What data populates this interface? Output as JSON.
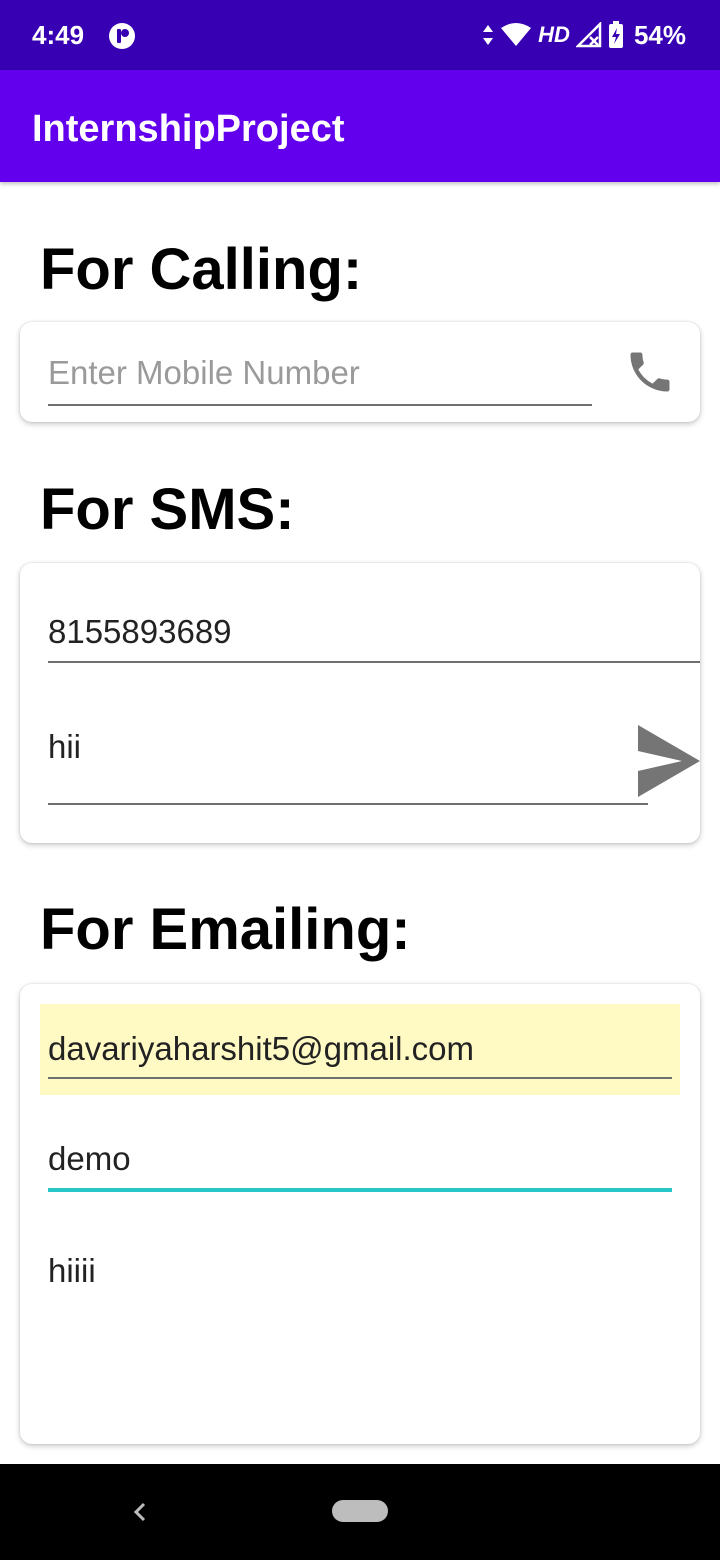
{
  "status_bar": {
    "time": "4:49",
    "network_label": "HD",
    "battery_percent": "54%",
    "icons": [
      "app-notification-icon",
      "data-arrows-icon",
      "wifi-icon",
      "signal-icon",
      "battery-icon"
    ]
  },
  "app_bar": {
    "title": "InternshipProject"
  },
  "calling": {
    "heading": "For Calling:",
    "mobile_placeholder": "Enter Mobile Number",
    "mobile_value": "",
    "call_icon": "phone-icon"
  },
  "sms": {
    "heading": "For SMS:",
    "number_value": "8155893689",
    "message_value": "hii",
    "send_icon": "send-icon"
  },
  "email": {
    "heading": "For Emailing:",
    "to_value": "davariyaharshit5@gmail.com",
    "subject_value": "demo",
    "body_value": "hiiii"
  },
  "nav_bar": {
    "icons": [
      "back-icon",
      "home-pill"
    ]
  },
  "colors": {
    "status_bar": "#3700b3",
    "app_bar": "#6200ee",
    "focus_underline": "#26c6c6",
    "autofill_highlight": "#fff9c4",
    "icon_gray": "#757575"
  }
}
